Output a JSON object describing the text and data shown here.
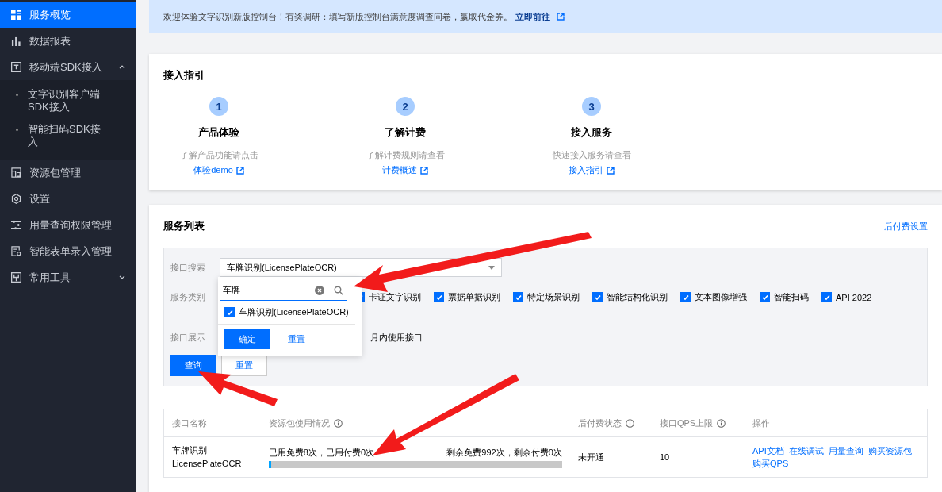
{
  "sidebar": {
    "items": [
      {
        "kind": "item",
        "label": "服务概览",
        "selected": true
      },
      {
        "kind": "item",
        "label": "数据报表",
        "selected": false
      },
      {
        "kind": "group",
        "label": "移动端SDK接入",
        "selected": false,
        "expanded": true,
        "children": [
          {
            "label": "文字识别客户端SDK接入",
            "selected": false
          },
          {
            "label": "智能扫码SDK接入",
            "selected": false
          }
        ]
      },
      {
        "kind": "item",
        "label": "资源包管理",
        "selected": false
      },
      {
        "kind": "item",
        "label": "设置",
        "selected": false
      },
      {
        "kind": "item",
        "label": "用量查询权限管理",
        "selected": false
      },
      {
        "kind": "item",
        "label": "智能表单录入管理",
        "selected": false
      },
      {
        "kind": "group",
        "label": "常用工具",
        "selected": false,
        "expanded": false
      }
    ]
  },
  "banner": {
    "text": "欢迎体验文字识别新版控制台！有奖调研：填写新版控制台满意度调查问卷，赢取代金券。",
    "link": "立即前往"
  },
  "guide": {
    "title": "接入指引",
    "steps": [
      {
        "number": "1",
        "title": "产品体验",
        "desc": "了解产品功能请点击",
        "link": "体验demo"
      },
      {
        "number": "2",
        "title": "了解计费",
        "desc": "了解计费规则请查看",
        "link": "计费概述"
      },
      {
        "number": "3",
        "title": "接入服务",
        "desc": "快速接入服务请查看",
        "link": "接入指引"
      }
    ]
  },
  "services": {
    "title": "服务列表",
    "settings_link": "后付费设置",
    "filters": {
      "search_label": "接口搜索",
      "search_value": "车牌识别(LicensePlateOCR)",
      "category_label": "服务类别",
      "categories": [
        {
          "label": "卡证文字识别",
          "checked": true
        },
        {
          "label": "票据单据识别",
          "checked": true
        },
        {
          "label": "特定场景识别",
          "checked": true
        },
        {
          "label": "智能结构化识别",
          "checked": true
        },
        {
          "label": "文本图像增强",
          "checked": true
        },
        {
          "label": "智能扫码",
          "checked": true
        },
        {
          "label": "API 2022",
          "checked": true
        }
      ],
      "display_label": "接口展示",
      "display_option": "月内使用接口",
      "query_button": "查询",
      "reset_button": "重置"
    },
    "popover": {
      "search_value": "车牌",
      "options": [
        {
          "label": "车牌识别(LicensePlateOCR)",
          "checked": true
        }
      ],
      "confirm_button": "确定",
      "reset_button": "重置"
    },
    "table": {
      "columns": [
        {
          "label": "接口名称",
          "info": false
        },
        {
          "label": "资源包使用情况",
          "info": true
        },
        {
          "label": "后付费状态",
          "info": true
        },
        {
          "label": "接口QPS上限",
          "info": true
        },
        {
          "label": "操作",
          "info": false
        }
      ],
      "rows": [
        {
          "name": "车牌识别",
          "api": "LicensePlateOCR",
          "used": "已用免费8次，已用付费0次",
          "remaining": "剩余免费992次，剩余付费0次",
          "level": 0.008,
          "status": "未开通",
          "qps": "10",
          "actions": [
            "API文档",
            "在线调试",
            "用量查询",
            "购买资源包",
            "购买QPS"
          ]
        }
      ]
    }
  }
}
